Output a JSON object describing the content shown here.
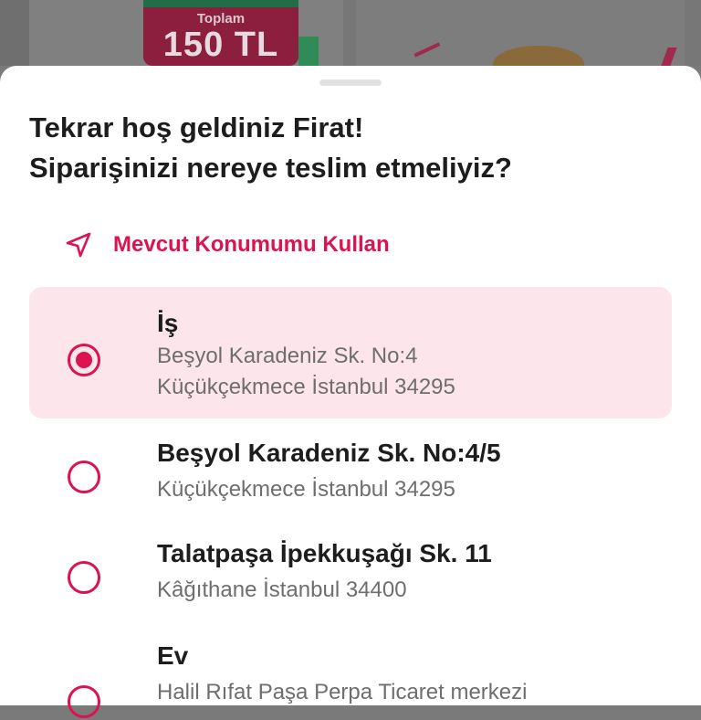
{
  "background": {
    "promo_label": "Toplam",
    "promo_value": "150 TL"
  },
  "colors": {
    "accent": "#dc1350",
    "selected_bg": "#fce5eb",
    "title_text": "#1d1d1d",
    "secondary_text": "#6e6e6e"
  },
  "sheet": {
    "title_line1": "Tekrar hoş geldiniz Firat!",
    "title_line2": "Siparişinizi nereye teslim etmeliyiz?",
    "use_location": {
      "icon": "navigation-arrow-icon",
      "label": "Mevcut Konumumu Kullan"
    },
    "addresses": [
      {
        "name": "İş",
        "line1": "Beşyol Karadeniz Sk. No:4",
        "line2": "Küçükçekmece İstanbul 34295",
        "selected": true
      },
      {
        "name": "Beşyol Karadeniz Sk. No:4/5",
        "line1": "Küçükçekmece İstanbul 34295",
        "selected": false
      },
      {
        "name": "Talatpaşa İpekkuşağı Sk. 11",
        "line1": "Kâğıthane İstanbul 34400",
        "selected": false
      },
      {
        "name": "Ev",
        "line1": "Halil Rıfat Paşa Perpa Ticaret merkezi",
        "selected": false
      }
    ]
  }
}
